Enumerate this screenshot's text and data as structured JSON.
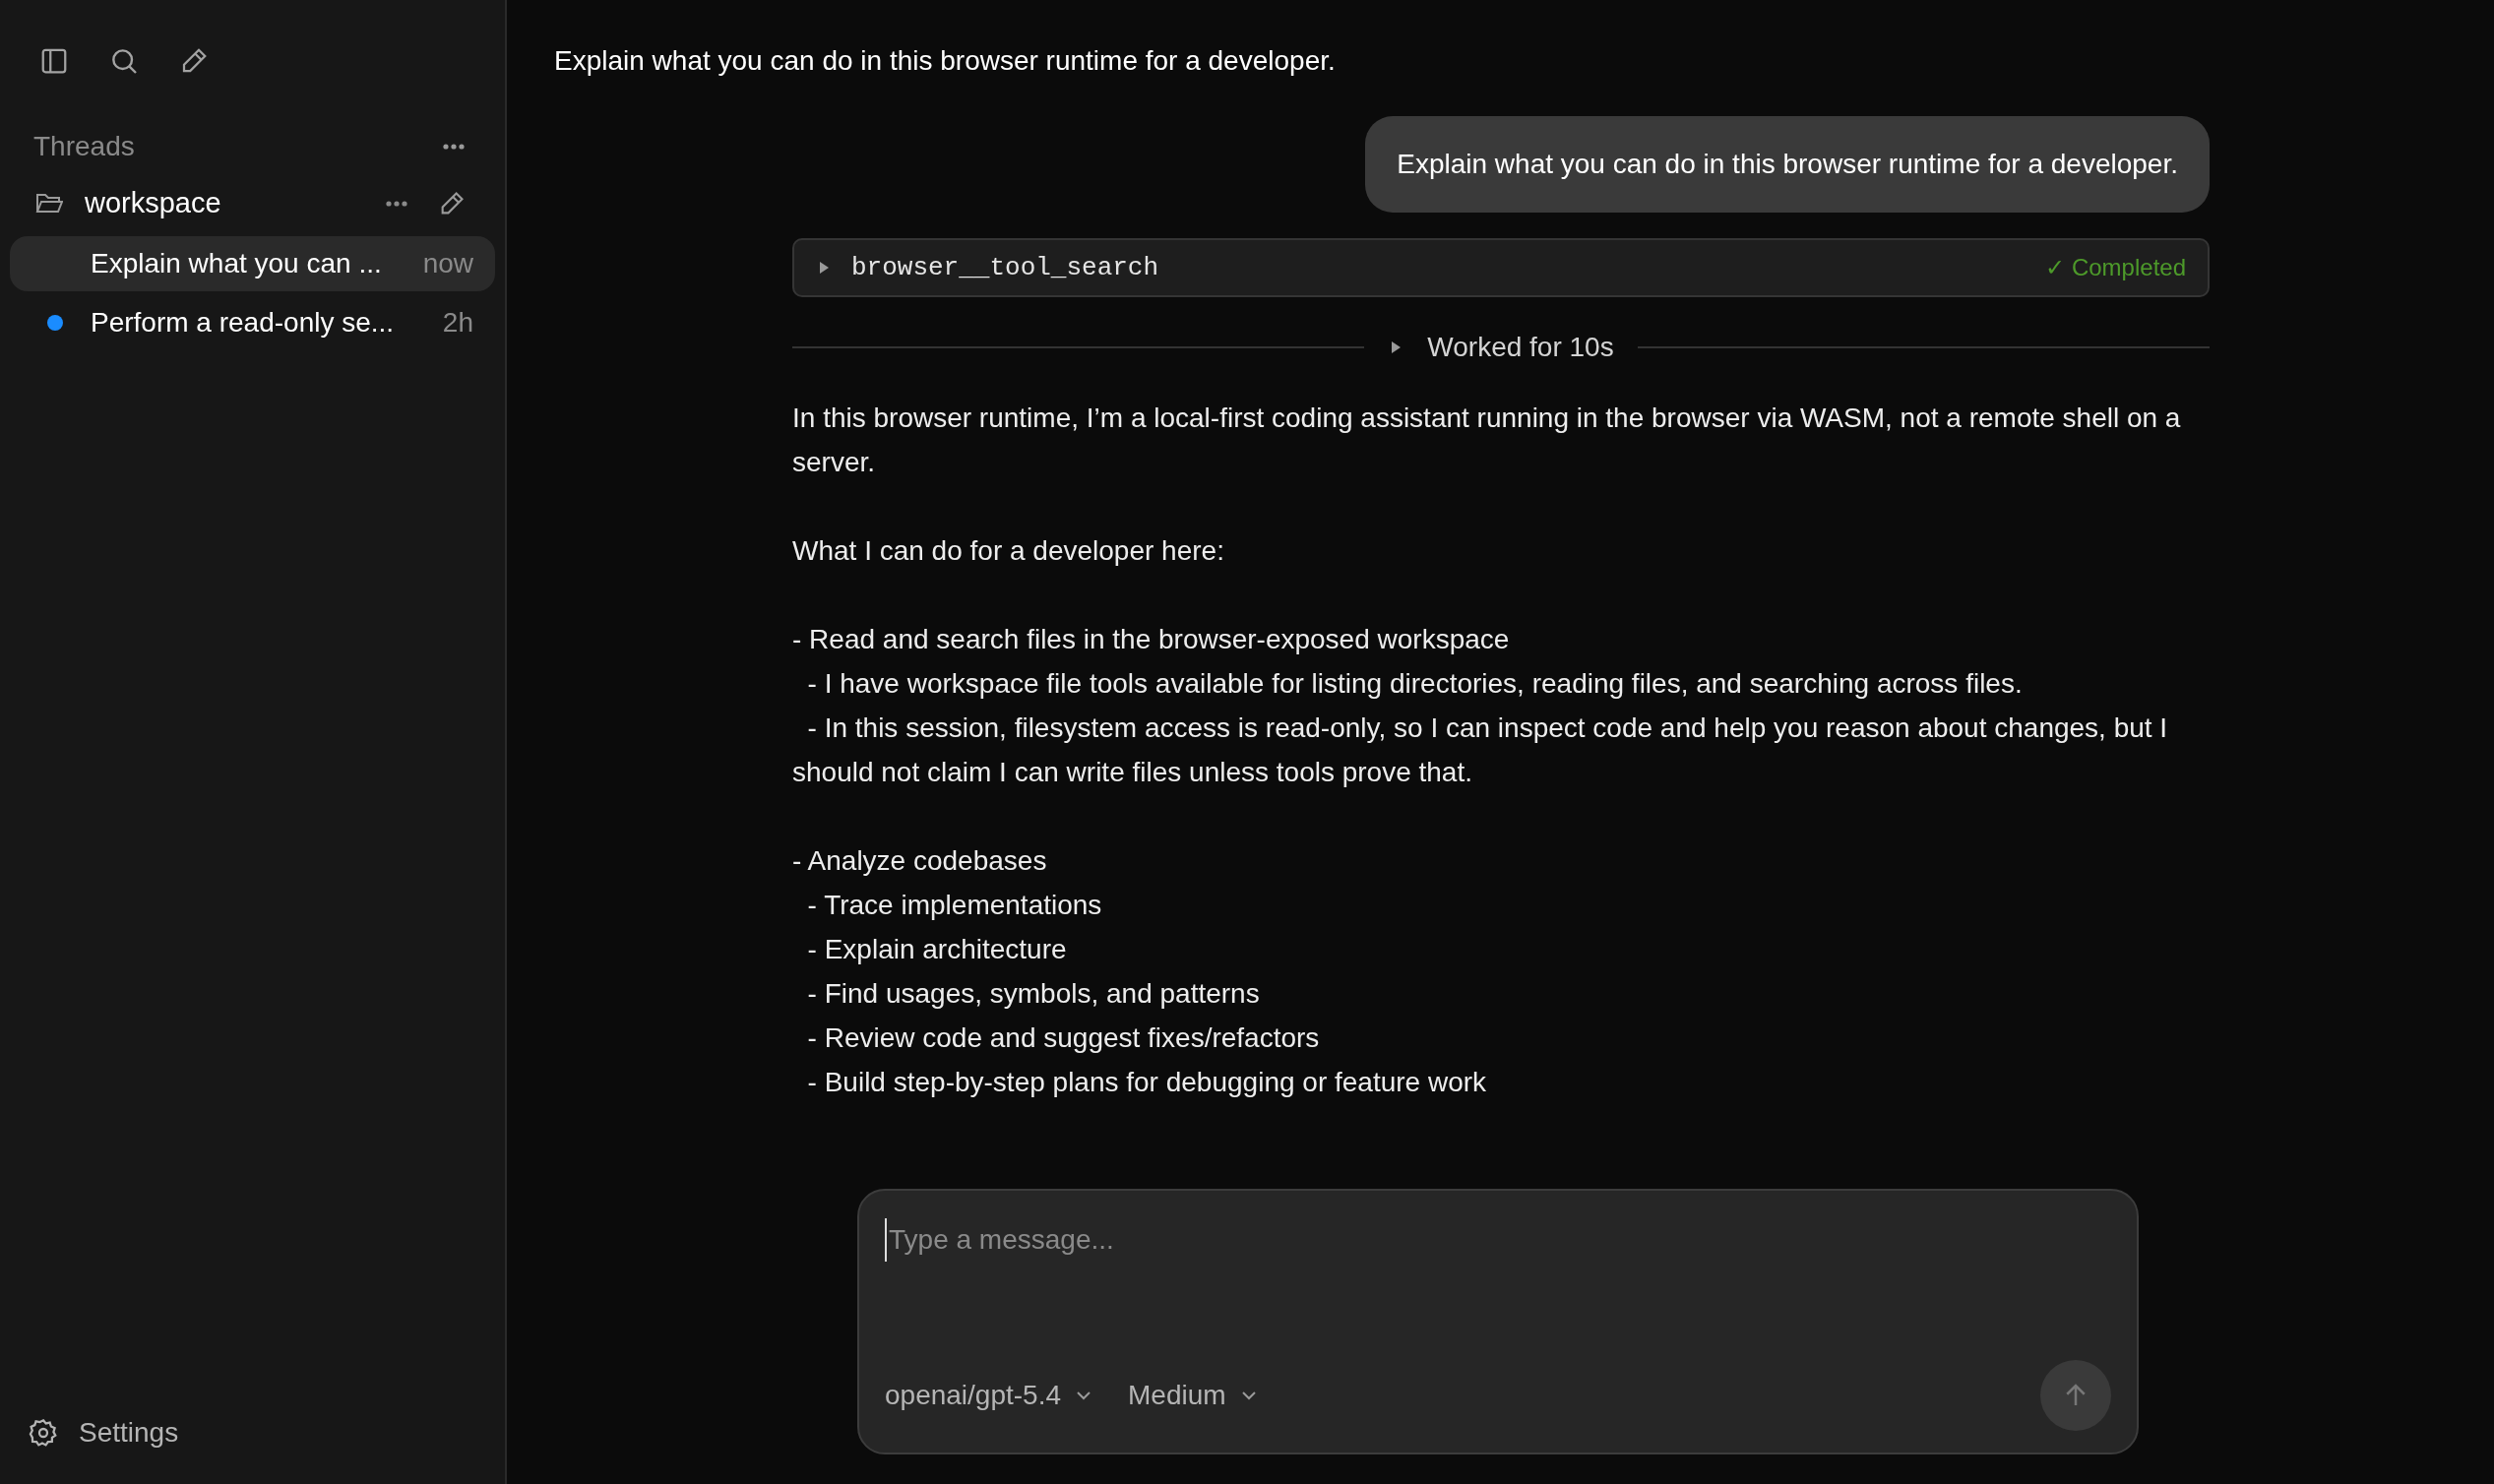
{
  "sidebar": {
    "section_title": "Threads",
    "folder": {
      "name": "workspace",
      "expanded": true
    },
    "threads": [
      {
        "title": "Explain what you can ...",
        "time": "now",
        "selected": true,
        "unread": false
      },
      {
        "title": "Perform a read-only se...",
        "time": "2h",
        "selected": false,
        "unread": true
      }
    ],
    "settings": "Settings"
  },
  "main": {
    "title": "Explain what you can do in this browser runtime for a developer.",
    "user_message": "Explain what you can do in this browser runtime for a developer.",
    "tool_call": {
      "name": "browser__tool_search",
      "status": "✓ Completed",
      "expanded": false
    },
    "worked": {
      "label": "Worked for 10s",
      "expanded": false
    },
    "answer": [
      [
        "In this browser runtime, I’m a local-first coding assistant running in the browser via WASM, not a remote shell on a server."
      ],
      [
        "What I can do for a developer here:"
      ],
      [
        "- Read and search files in the browser-exposed workspace",
        "  - I have workspace file tools available for listing directories, reading files, and searching across files.",
        "  - In this session, filesystem access is read-only, so I can inspect code and help you reason about changes, but I should not claim I can write files unless tools prove that."
      ],
      [
        "- Analyze codebases",
        "  - Trace implementations",
        "  - Explain architecture",
        "  - Find usages, symbols, and patterns",
        "  - Review code and suggest fixes/refactors",
        "  - Build step-by-step plans for debugging or feature work"
      ]
    ]
  },
  "composer": {
    "placeholder": "Type a message...",
    "model": "openai/gpt-5.4",
    "effort": "Medium",
    "send_disabled": true
  }
}
